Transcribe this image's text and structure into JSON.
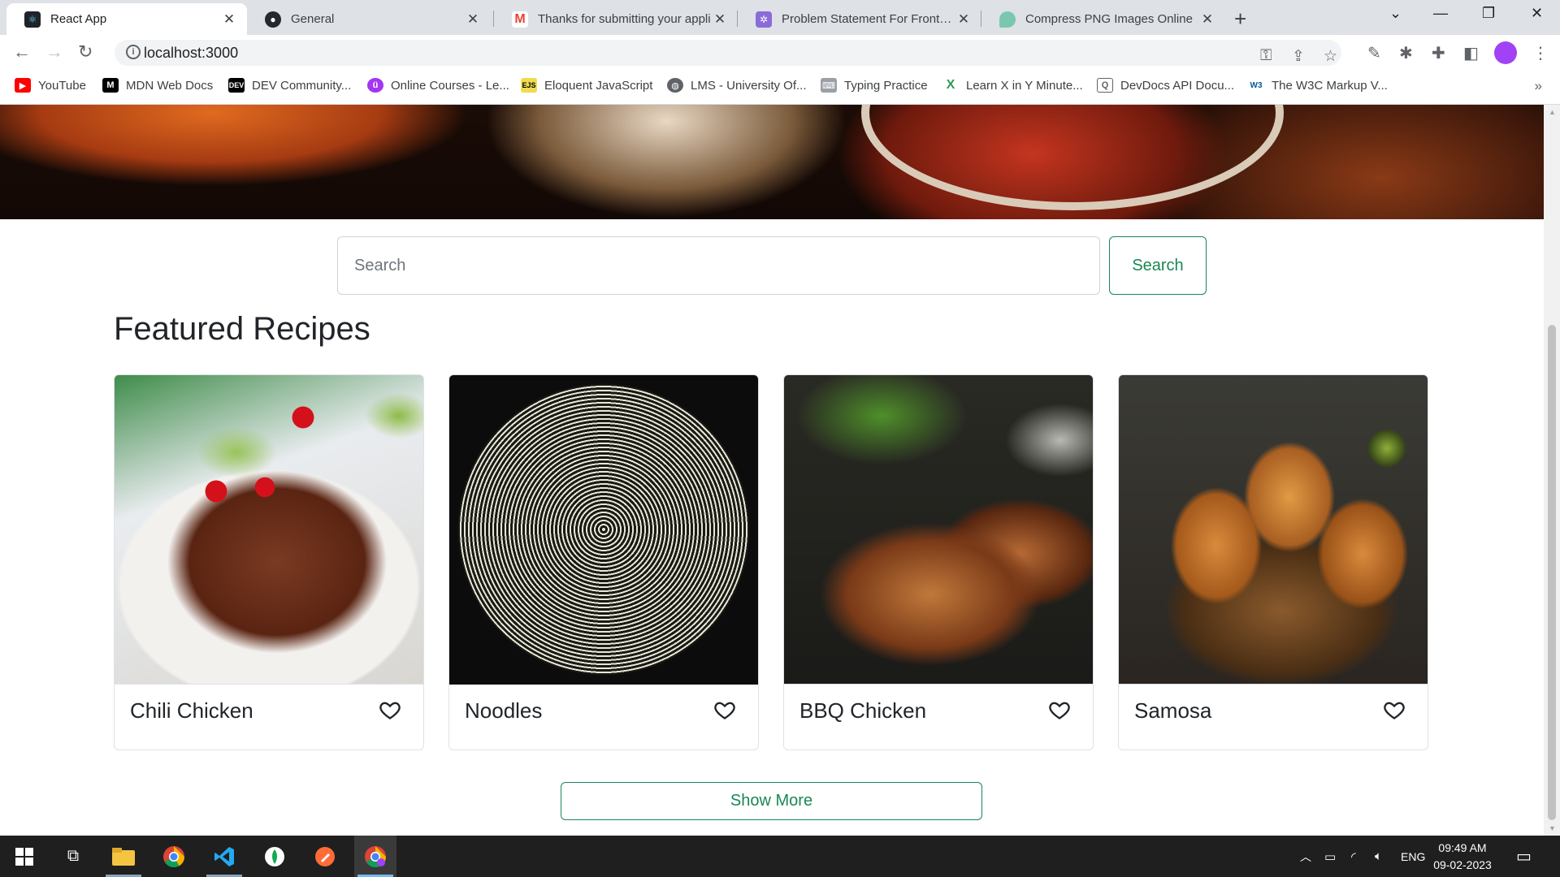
{
  "browser": {
    "tabs": [
      {
        "title": "React App",
        "favicon": "react-icon",
        "active": true
      },
      {
        "title": "General",
        "favicon": "github-icon",
        "active": false
      },
      {
        "title": "Thanks for submitting your appli",
        "favicon": "gmail-icon",
        "active": false
      },
      {
        "title": "Problem Statement For Frontend",
        "favicon": "app-icon",
        "active": false
      },
      {
        "title": "Compress PNG Images Online",
        "favicon": "tinypng-icon",
        "active": false
      }
    ],
    "url": "localhost:3000",
    "bookmarks": [
      {
        "label": "YouTube",
        "icon": "youtube-icon",
        "color": "#ff0000"
      },
      {
        "label": "MDN Web Docs",
        "icon": "mdn-icon",
        "color": "#000000"
      },
      {
        "label": "DEV Community...",
        "icon": "dev-icon",
        "color": "#000000"
      },
      {
        "label": "Online Courses - Le...",
        "icon": "udemy-icon",
        "color": "#a435f0"
      },
      {
        "label": "Eloquent JavaScript",
        "icon": "ejs-icon",
        "color": "#f0db4f"
      },
      {
        "label": "LMS - University Of...",
        "icon": "globe-icon",
        "color": "#5f6368"
      },
      {
        "label": "Typing Practice",
        "icon": "keyboard-icon",
        "color": "#9aa0a6"
      },
      {
        "label": "Learn X in Y Minute...",
        "icon": "x-icon",
        "color": "#2e9c5a"
      },
      {
        "label": "DevDocs API Docu...",
        "icon": "devdocs-icon",
        "color": "#5f6368"
      },
      {
        "label": "The W3C Markup V...",
        "icon": "w3c-icon",
        "color": "#005a9c"
      }
    ]
  },
  "page": {
    "search": {
      "placeholder": "Search",
      "button_label": "Search"
    },
    "section_title": "Featured Recipes",
    "recipes": [
      {
        "name": "Chili Chicken"
      },
      {
        "name": "Noodles"
      },
      {
        "name": "BBQ Chicken"
      },
      {
        "name": "Samosa"
      }
    ],
    "show_more_label": "Show More"
  },
  "taskbar": {
    "language": "ENG",
    "time": "09:49 AM",
    "date": "09-02-2023"
  },
  "colors": {
    "accent": "#198754",
    "taskbar": "#1f1f1f"
  }
}
